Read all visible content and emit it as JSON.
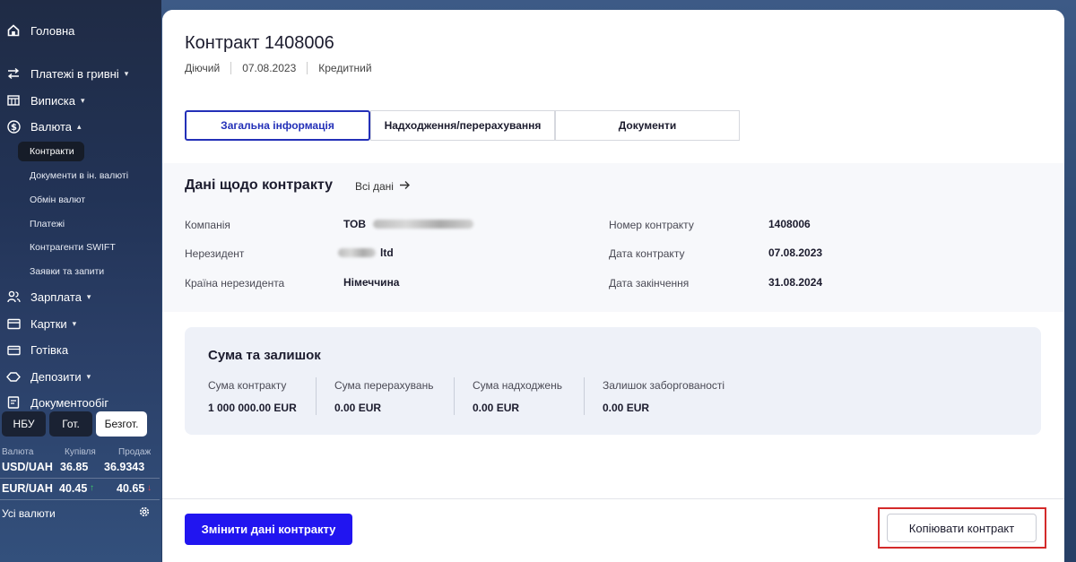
{
  "sidebar": {
    "items": [
      {
        "label": "Головна",
        "icon": "home-icon"
      },
      {
        "label": "Платежі в гривні",
        "icon": "transfer-icon"
      },
      {
        "label": "Виписка",
        "icon": "statement-icon"
      },
      {
        "label": "Валюта",
        "icon": "currency-icon"
      },
      {
        "label": "Зарплата",
        "icon": "people-icon"
      },
      {
        "label": "Картки",
        "icon": "card-icon"
      },
      {
        "label": "Готівка",
        "icon": "cash-icon"
      },
      {
        "label": "Депозити",
        "icon": "deposit-icon"
      },
      {
        "label": "Документообіг",
        "icon": "document-icon"
      }
    ],
    "currency_sub": [
      {
        "label": "Контракти"
      },
      {
        "label": "Документи в ін. валюті"
      },
      {
        "label": "Обмін валют"
      },
      {
        "label": "Платежі"
      },
      {
        "label": "Контрагенти SWIFT"
      },
      {
        "label": "Заявки та запити"
      }
    ],
    "rate_tabs": [
      "НБУ",
      "Гот.",
      "Безгот."
    ],
    "rates_header": {
      "currency": "Валюта",
      "buy": "Купівля",
      "sell": "Продаж"
    },
    "rates": [
      {
        "pair": "USD/UAH",
        "buy": "36.85",
        "sell": "36.9343"
      },
      {
        "pair": "EUR/UAH",
        "buy": "40.45",
        "sell": "40.65",
        "buy_arrow": "↑",
        "sell_arrow": "↓"
      }
    ],
    "all_currencies": "Усі валюти"
  },
  "contract": {
    "title": "Контракт 1408006",
    "status": "Діючий",
    "date": "07.08.2023",
    "type": "Кредитний"
  },
  "tabs": [
    "Загальна інформація",
    "Надходження/перерахування",
    "Документи"
  ],
  "details": {
    "title": "Дані щодо контракту",
    "all_data_link": "Всі дані",
    "company_label": "Компанія",
    "company_value": "ТОВ",
    "nonresident_label": "Нерезидент",
    "nonresident_value": "ltd",
    "country_label": "Країна нерезидента",
    "country_value": "Німеччина",
    "number_label": "Номер контракту",
    "number_value": "1408006",
    "contract_date_label": "Дата контракту",
    "contract_date_value": "07.08.2023",
    "end_date_label": "Дата закінчення",
    "end_date_value": "31.08.2024"
  },
  "sums": {
    "title": "Сума та залишок",
    "columns": [
      {
        "label": "Сума контракту",
        "value": "1 000 000.00 EUR"
      },
      {
        "label": "Сума перерахувань",
        "value": "0.00 EUR"
      },
      {
        "label": "Сума надходжень",
        "value": "0.00 EUR"
      },
      {
        "label": "Залишок заборгованості",
        "value": "0.00 EUR"
      }
    ]
  },
  "footer": {
    "edit_button": "Змінити дані контракту",
    "copy_button": "Копіювати контракт"
  },
  "colors": {
    "primary": "#2115f0",
    "tab_active": "#2330b8",
    "highlight": "#d42a2a"
  }
}
